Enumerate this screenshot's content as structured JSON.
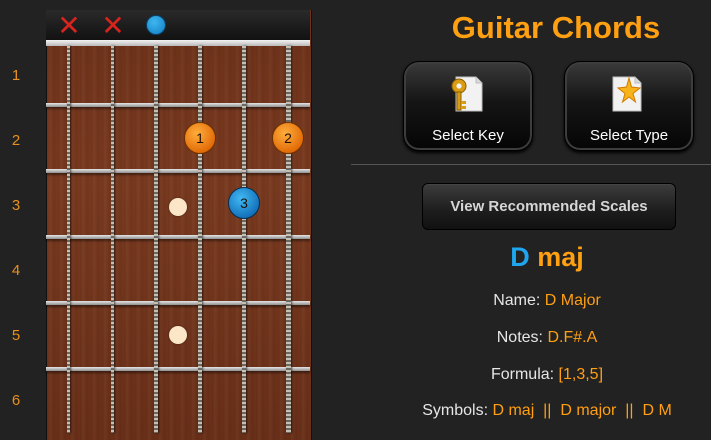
{
  "fret_numbers": [
    "1",
    "2",
    "3",
    "4",
    "5",
    "6"
  ],
  "fretboard": {
    "string_states": [
      "muted",
      "muted",
      "open",
      "fretted",
      "fretted",
      "fretted"
    ],
    "fingers": [
      {
        "label": "1",
        "string": 4,
        "fret": 2,
        "color": "#f08a15"
      },
      {
        "label": "2",
        "string": 6,
        "fret": 2,
        "color": "#f08a15"
      },
      {
        "label": "3",
        "string": 5,
        "fret": 3,
        "color": "#1d8fd8"
      }
    ],
    "inlay_frets": [
      3,
      5
    ],
    "muted_icon": "x-icon",
    "open_icon": "open-string-dot-icon"
  },
  "title": "Guitar Chords",
  "buttons": {
    "select_key": {
      "label": "Select Key",
      "icon": "key-document-icon"
    },
    "select_type": {
      "label": "Select Type",
      "icon": "star-document-icon"
    }
  },
  "scales_button": "View Recommended Scales",
  "chord": {
    "root": "D",
    "quality": "maj"
  },
  "info": {
    "name_label": "Name:",
    "name_value": "D Major",
    "notes_label": "Notes:",
    "notes_value": "D.F#.A",
    "formula_label": "Formula:",
    "formula_value": "[1,3,5]",
    "symbols_label": "Symbols:",
    "symbols_value": "D maj  ||  D major  ||  D M"
  },
  "colors": {
    "accent_orange": "#ff9f12",
    "accent_blue": "#1ea6ee",
    "background": "#222222"
  }
}
